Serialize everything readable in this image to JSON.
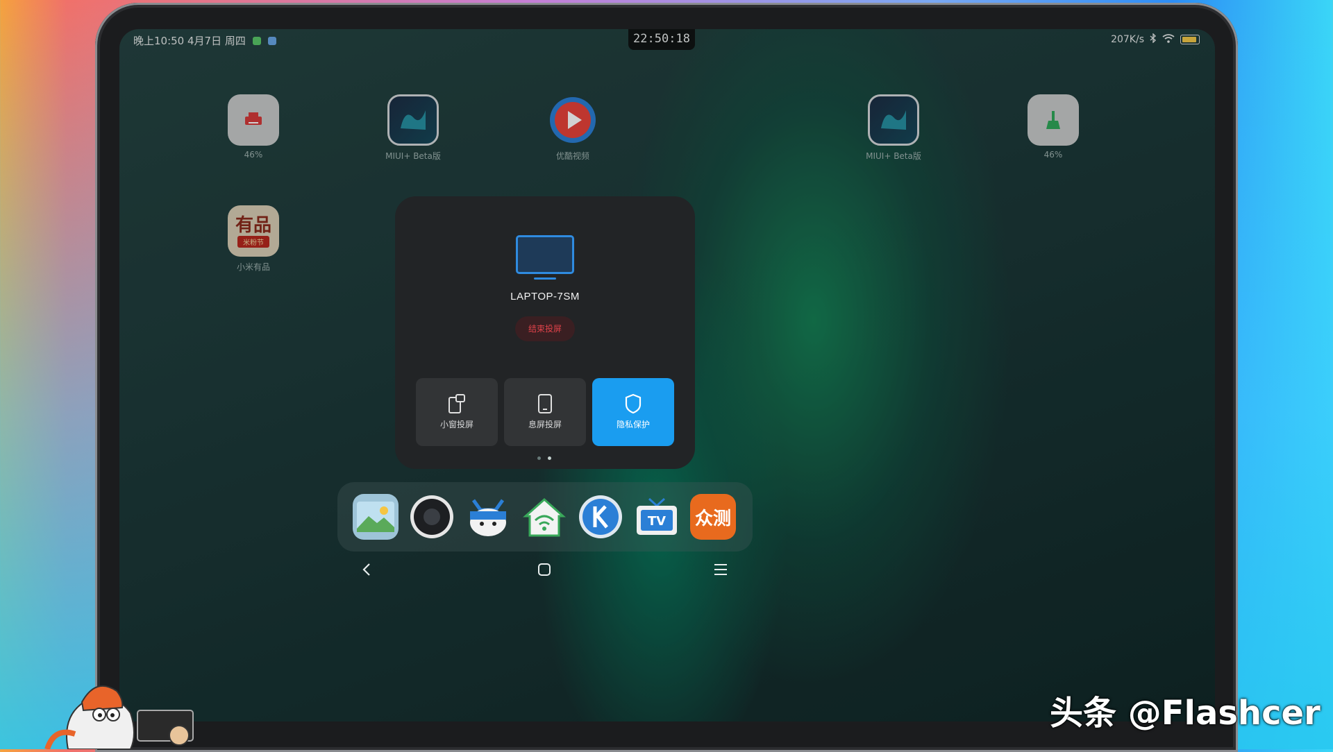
{
  "status_bar": {
    "left_text": "晚上10:50 4月7日 周四",
    "clock": "22:50:18",
    "net_speed": "207K/s"
  },
  "home_apps": [
    {
      "label": "46%",
      "icon": "printer-icon"
    },
    {
      "label": "MIUI+ Beta版",
      "icon": "miui-plus-icon"
    },
    {
      "label": "优酷视频",
      "icon": "youku-icon"
    },
    {
      "label": "MIUI+ Beta版",
      "icon": "miui-plus-icon"
    },
    {
      "label": "46%",
      "icon": "broom-cleaner-icon"
    },
    {
      "label": "小米有品",
      "icon": "youpin-icon",
      "icon_text": "有品",
      "icon_banner": "米粉节"
    }
  ],
  "cast_panel": {
    "device_name": "LAPTOP-7SM",
    "end_button": "结束投屏",
    "tiles": [
      {
        "label": "小窗投屏",
        "icon": "small-window-icon",
        "active": false
      },
      {
        "label": "息屏投屏",
        "icon": "phone-screen-off-icon",
        "active": false
      },
      {
        "label": "隐私保护",
        "icon": "shield-icon",
        "active": true
      }
    ],
    "accent_color": "#1a9df0",
    "danger_color": "#e0424a"
  },
  "pager": {
    "pages": 2,
    "current": 2
  },
  "dock": [
    {
      "icon": "gallery-icon"
    },
    {
      "icon": "camera-icon"
    },
    {
      "icon": "mi-bunny-icon"
    },
    {
      "icon": "home-wifi-icon"
    },
    {
      "icon": "k-song-icon"
    },
    {
      "icon": "tv-icon"
    },
    {
      "icon": "zhongce-icon",
      "icon_text": "众测"
    }
  ],
  "navbar": {
    "back": "back-icon",
    "home": "home-icon",
    "menu": "menu-icon"
  },
  "watermark": "头条 @Flashcer"
}
